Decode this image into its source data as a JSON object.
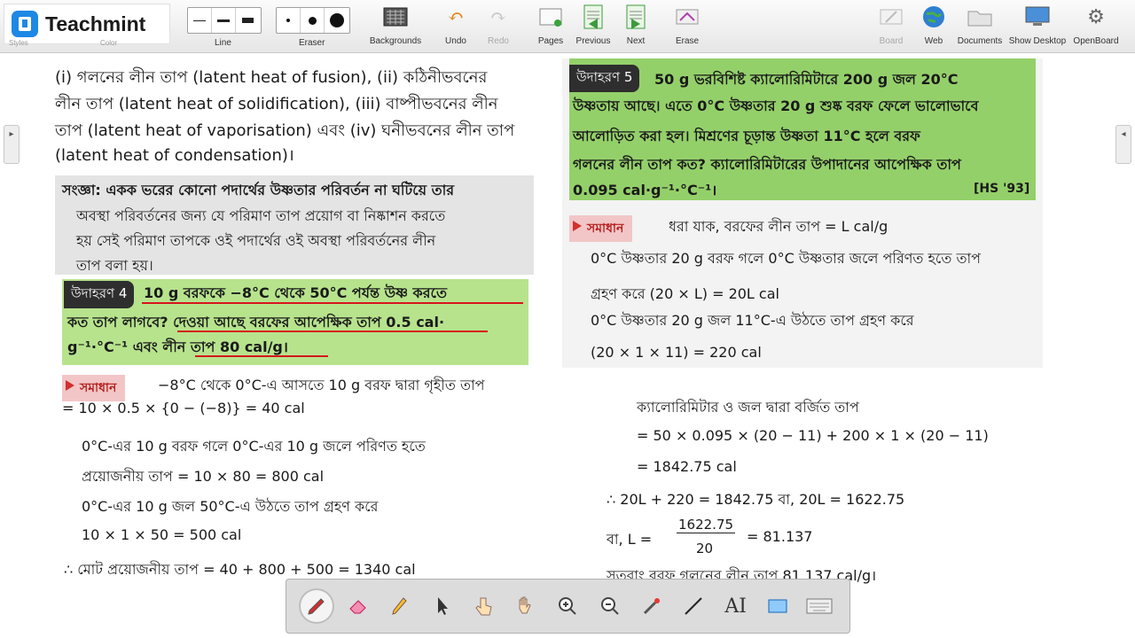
{
  "app": {
    "brand": "Teachmint",
    "accent": "#1e88e5"
  },
  "toolbar": {
    "faint_labels": [
      "Styles",
      "Color"
    ],
    "line_label": "Line",
    "eraser_label": "Eraser",
    "backgrounds": "Backgrounds",
    "undo": "Undo",
    "redo": "Redo",
    "pages": "Pages",
    "previous": "Previous",
    "next": "Next",
    "erase": "Erase",
    "board": "Board",
    "web": "Web",
    "documents": "Documents",
    "show_desktop": "Show Desktop",
    "openboard": "OpenBoard"
  },
  "left": {
    "p1": [
      "(i) গলনের লীন তাপ (latent heat of fusion), (ii) কঠিনীভবনের",
      "লীন তাপ (latent heat of solidification), (iii) বাষ্পীভবনের লীন",
      "তাপ (latent heat of vaporisation) এবং (iv) ঘনীভবনের লীন তাপ",
      "(latent heat of condensation)।"
    ],
    "def": [
      "সংজ্ঞা: একক ভরের কোনো পদার্থের উষ্ণতার পরিবর্তন না ঘটিয়ে তার",
      "অবস্থা পরিবর্তনের জন্য যে পরিমাণ তাপ প্রয়োগ বা নিষ্কাশন করতে",
      "হয় সেই পরিমাণ তাপকে ওই পদার্থের ওই অবস্থা পরিবর্তনের লীন",
      "তাপ বলা হয়।"
    ],
    "ex_tag": "উদাহরণ 4",
    "ex": [
      "10 g বরফকে −8°C থেকে 50°C পর্যন্ত উষ্ণ করতে",
      "কত তাপ লাগবে? দেওয়া আছে বরফের আপেক্ষিক তাপ 0.5 cal·",
      "g⁻¹·°C⁻¹ এবং লীন তাপ 80 cal/g।"
    ],
    "sol_tag": "সমাধান",
    "sol": [
      "−8°C থেকে 0°C-এ আসতে 10 g বরফ দ্বারা গৃহীত তাপ",
      "= 10 × 0.5 × {0 − (−8)} = 40 cal",
      "0°C-এর 10 g বরফ গলে 0°C-এর 10 g জলে পরিণত হতে",
      "প্রয়োজনীয় তাপ = 10 × 80 = 800 cal",
      "0°C-এর 10 g জল 50°C-এ উঠতে তাপ গ্রহণ করে",
      "10 × 1 × 50 = 500 cal",
      "∴ মোট প্রয়োজনীয় তাপ = 40 + 800 + 500 = 1340 cal"
    ]
  },
  "right": {
    "ex_tag": "উদাহরণ 5",
    "ex": [
      "50 g ভরবিশিষ্ট ক্যালোরিমিটারে 200 g জল 20°C",
      "উষ্ণতায় আছে। এতে 0°C উষ্ণতার 20 g শুষ্ক বরফ ফেলে ভালোভাবে",
      "আলোড়িত করা হল। মিশ্রণের চূড়ান্ত উষ্ণতা 11°C হলে বরফ",
      "গলনের লীন তাপ কত? ক্যালোরিমিটারের উপাদানের আপেক্ষিক তাপ",
      "0.095 cal·g⁻¹·°C⁻¹।"
    ],
    "ref": "[HS '93]",
    "sol_tag": "সমাধান",
    "sol": [
      "ধরা যাক, বরফের লীন তাপ = L cal/g",
      "0°C উষ্ণতার 20 g বরফ গলে 0°C উষ্ণতার জলে পরিণত হতে তাপ",
      "গ্রহণ করে (20 × L) = 20L cal",
      "0°C উষ্ণতার 20 g জল 11°C-এ উঠতে তাপ গ্রহণ করে",
      "(20 × 1 × 11) = 220 cal",
      "ক্যালোরিমিটার ও জল দ্বারা বর্জিত তাপ",
      "= 50 × 0.095 × (20 − 11) + 200 × 1 × (20 − 11)",
      "= 1842.75 cal",
      "∴   20L + 220 = 1842.75   বা,   20L = 1622.75",
      "বা,  L =",
      "1622.75",
      "20",
      "= 81.137",
      "সুতরাং বরফ গলনের লীন তাপ 81.137 cal/g।"
    ]
  },
  "pen_tools": {
    "pen": "pen-icon",
    "eraser": "eraser-icon",
    "marker": "highlighter-icon",
    "select": "pointer-icon",
    "interact": "hand-point-icon",
    "hand": "hand-icon",
    "zoom_in": "zoom-in-icon",
    "zoom_out": "zoom-out-icon",
    "laser": "laser-icon",
    "line": "line-icon",
    "text": "AI",
    "capture": "capture-icon",
    "keyboard": "keyboard-icon"
  }
}
